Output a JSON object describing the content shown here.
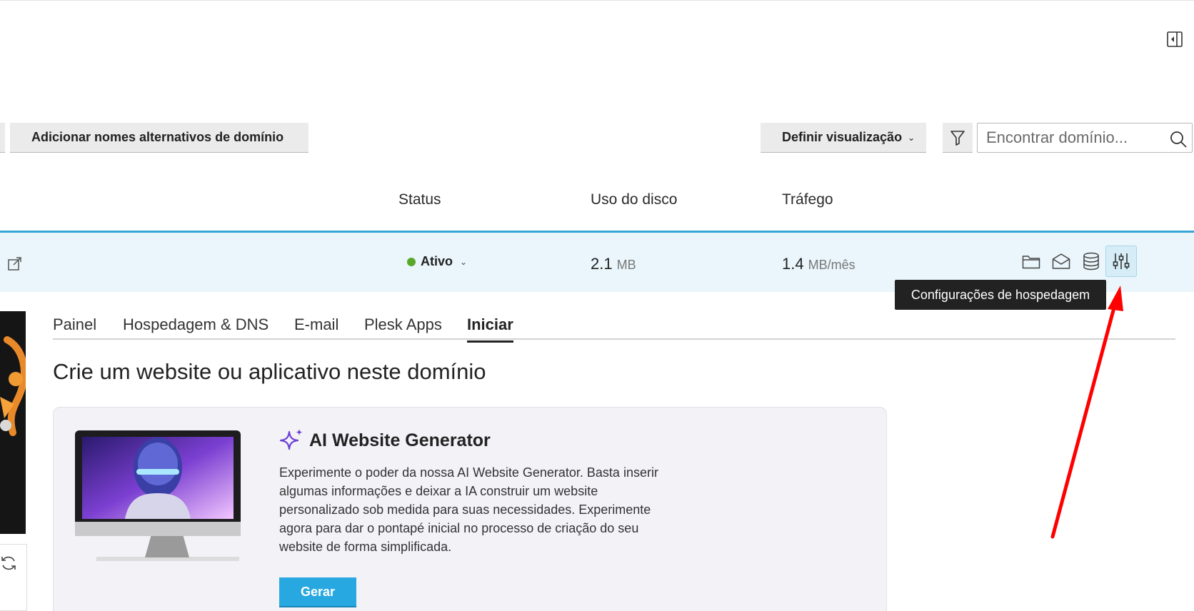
{
  "toolbar": {
    "add_aliases_label": "Adicionar nomes alternativos de domínio",
    "view_label": "Definir visualização",
    "search_placeholder": "Encontrar domínio..."
  },
  "table": {
    "columns": [
      "Status",
      "Uso do disco",
      "Tráfego"
    ],
    "row": {
      "status": "Ativo",
      "status_color": "#59a827",
      "disk_value": "2.1",
      "disk_unit": "MB",
      "traffic_value": "1.4",
      "traffic_unit": "MB/mês",
      "actions": [
        "folder-icon",
        "mail-icon",
        "database-icon",
        "hosting-settings-icon"
      ]
    }
  },
  "tooltip": "Configurações de hospedagem",
  "tabs": [
    {
      "label": "Painel",
      "active": false
    },
    {
      "label": "Hospedagem & DNS",
      "active": false
    },
    {
      "label": "E-mail",
      "active": false
    },
    {
      "label": "Plesk Apps",
      "active": false
    },
    {
      "label": "Iniciar",
      "active": true
    }
  ],
  "section_title": "Crie um website ou aplicativo neste domínio",
  "ai_card": {
    "title": "AI Website Generator",
    "description": "Experimente o poder da nossa AI Website Generator. Basta inserir algumas informações e deixar a IA construir um website personalizado sob medida para suas necessidades. Experimente agora para dar o pontapé inicial no processo de criação do seu website de forma simplificada.",
    "button_label": "Gerar",
    "accent": "#28a8e0"
  },
  "annotation": {
    "color": "#ff0000"
  }
}
